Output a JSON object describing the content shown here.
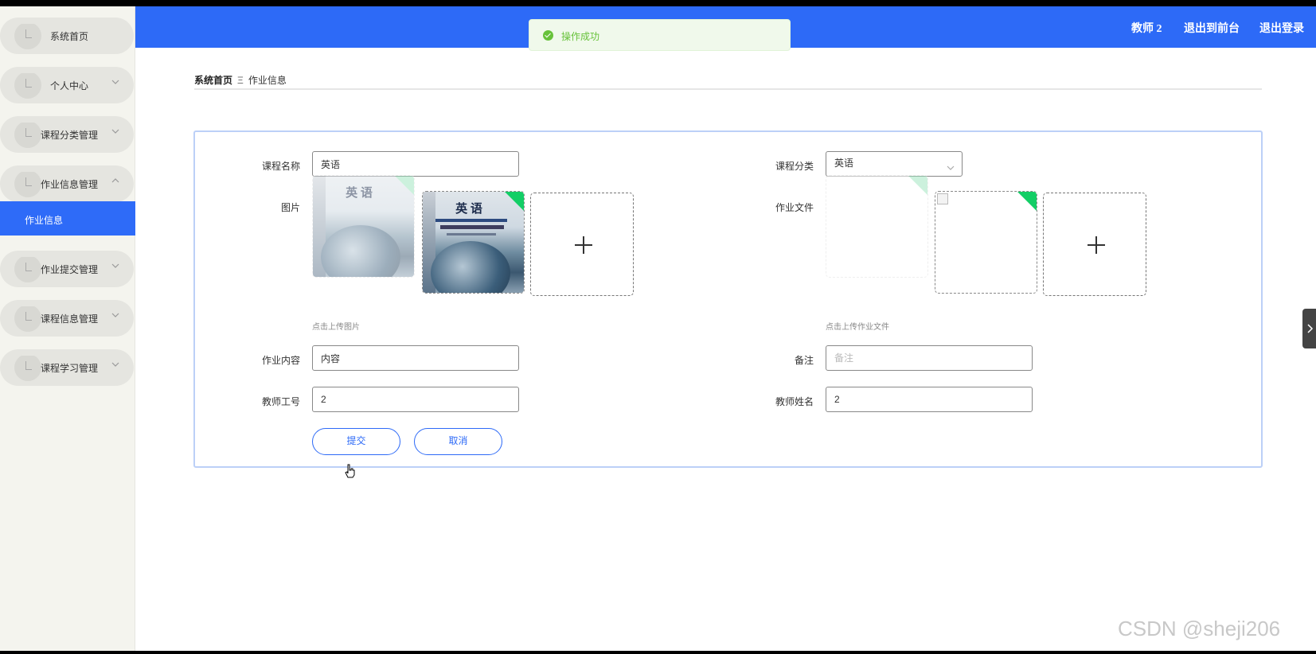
{
  "sidebar": {
    "items": [
      {
        "label": "系统首页",
        "has_chevron": false
      },
      {
        "label": "个人中心",
        "has_chevron": true
      },
      {
        "label": "课程分类管理",
        "has_chevron": true
      },
      {
        "label": "作业信息管理",
        "has_chevron": true,
        "expanded": true
      },
      {
        "label": "作业提交管理",
        "has_chevron": true
      },
      {
        "label": "课程信息管理",
        "has_chevron": true
      },
      {
        "label": "课程学习管理",
        "has_chevron": true
      }
    ],
    "active_sub_item": "作业信息"
  },
  "header": {
    "user": "教师 2",
    "to_front": "退出到前台",
    "logout": "退出登录"
  },
  "toast": {
    "message": "操作成功",
    "type": "success"
  },
  "breadcrumb": {
    "home": "系统首页",
    "separator": "Ξ",
    "current": "作业信息"
  },
  "form": {
    "course_name": {
      "label": "课程名称",
      "value": "英语"
    },
    "course_category": {
      "label": "课程分类",
      "value": "英语"
    },
    "image": {
      "label": "图片",
      "hint": "点击上传图片",
      "book_title": "英 语"
    },
    "homework_file": {
      "label": "作业文件",
      "hint": "点击上传作业文件"
    },
    "homework_content": {
      "label": "作业内容",
      "value": "内容"
    },
    "remark": {
      "label": "备注",
      "value": "",
      "placeholder": "备注"
    },
    "teacher_id": {
      "label": "教师工号",
      "value": "2"
    },
    "teacher_name": {
      "label": "教师姓名",
      "value": "2"
    },
    "submit_label": "提交",
    "cancel_label": "取消"
  },
  "watermark": "CSDN @sheji206",
  "colors": {
    "primary": "#2d6af7",
    "sidebar_bg": "#f4f4ee",
    "success": "#67c23a",
    "corner_badge": "#13ce66"
  }
}
